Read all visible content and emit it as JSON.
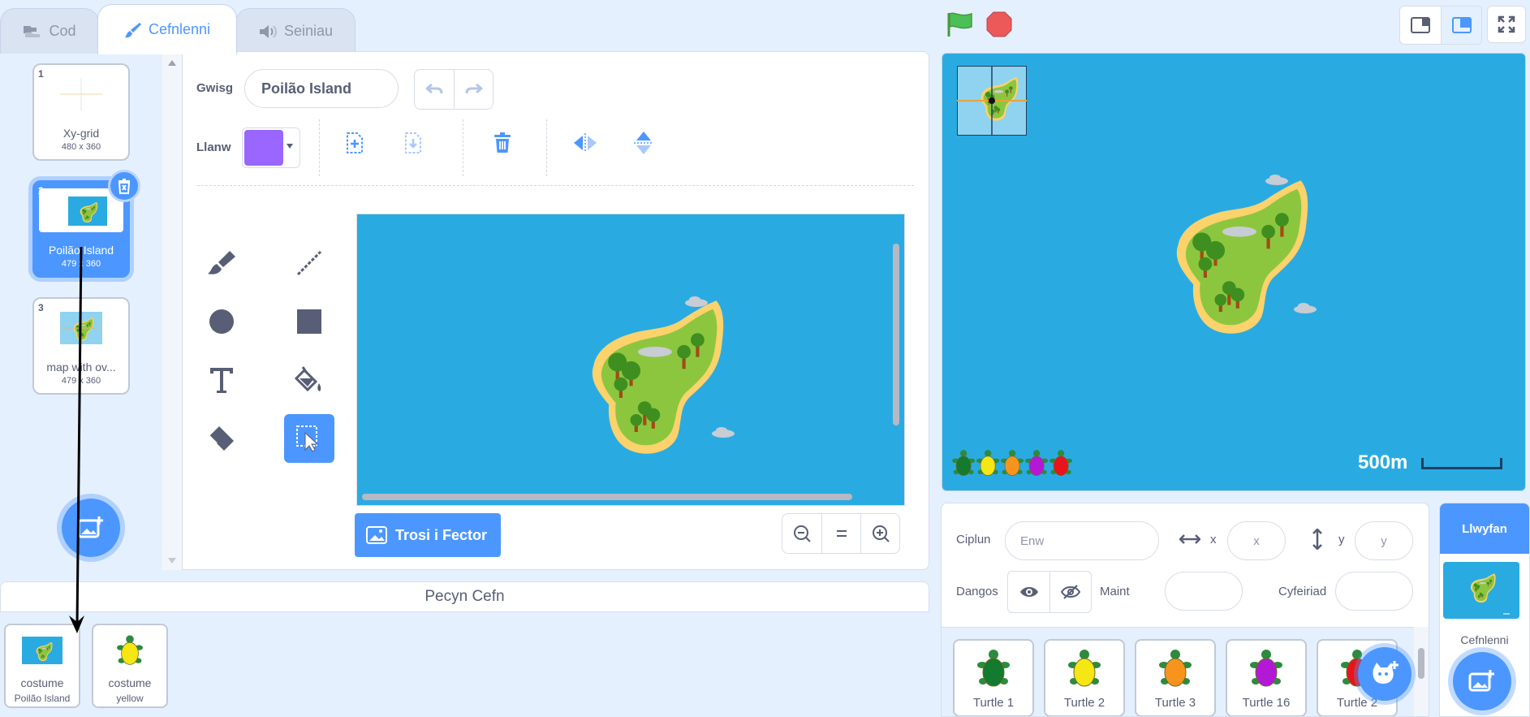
{
  "tabs": [
    {
      "label": "Cod",
      "icon": "code-blocks-icon"
    },
    {
      "label": "Cefnlenni",
      "icon": "paintbrush-icon"
    },
    {
      "label": "Seiniau",
      "icon": "speaker-icon"
    }
  ],
  "backdrops": [
    {
      "index": "1",
      "name": "Xy-grid",
      "size": "480 x 360"
    },
    {
      "index": "2",
      "name": "Poilão Island",
      "size": "479 x 360"
    },
    {
      "index": "3",
      "name": "map with ov...",
      "size": "479 x 360"
    }
  ],
  "editor": {
    "costume_label": "Gwisg",
    "costume_name": "Poilão Island",
    "fill_label": "Llanw",
    "fill_color": "#9966ff",
    "convert_button": "Trosi i Fector"
  },
  "backpack": {
    "title": "Pecyn Cefn",
    "items": [
      {
        "type": "costume",
        "name": "Poilão Island"
      },
      {
        "type": "costume",
        "name": "yellow"
      }
    ]
  },
  "stage": {
    "scale_label": "500m"
  },
  "sprite_info": {
    "sprite_label": "Ciplun",
    "sprite_placeholder": "Enw",
    "x_label": "x",
    "x_placeholder": "x",
    "y_label": "y",
    "y_placeholder": "y",
    "show_label": "Dangos",
    "size_label": "Maint",
    "direction_label": "Cyfeiriad"
  },
  "sprites": [
    {
      "name": "Turtle 1",
      "color": "#137a2e"
    },
    {
      "name": "Turtle 2",
      "color": "#f5e614"
    },
    {
      "name": "Turtle 3",
      "color": "#f7941d"
    },
    {
      "name": "Turtle 16",
      "color": "#b318d6"
    },
    {
      "name": "Turtle 2",
      "color": "#e8141b"
    }
  ],
  "stage_target": {
    "header": "Llwyfan",
    "label": "Cefnlenni"
  },
  "colors": {
    "accent": "#4c97ff",
    "stage_water": "#29abe2"
  }
}
